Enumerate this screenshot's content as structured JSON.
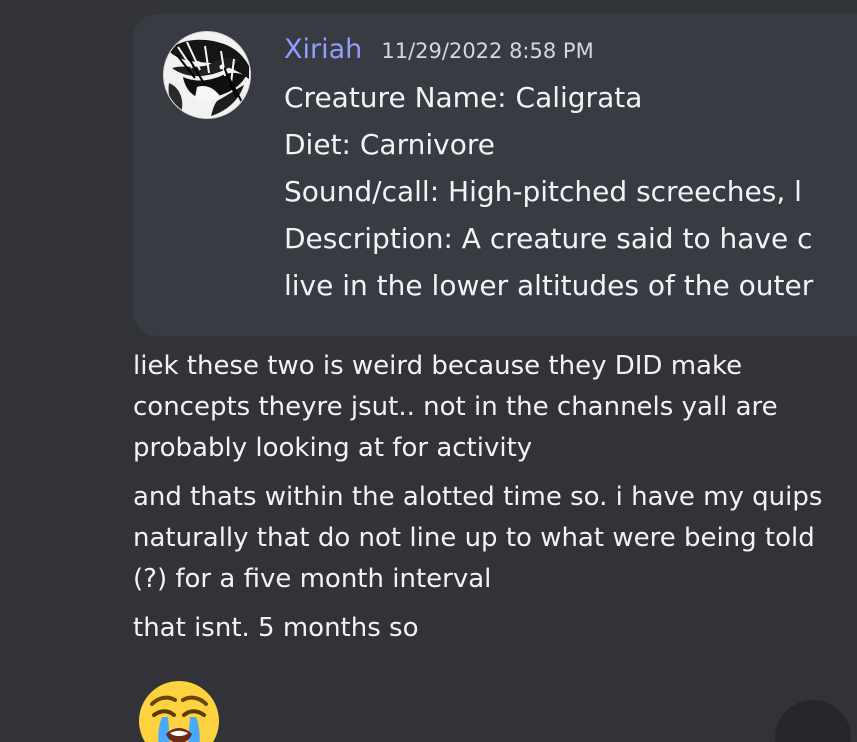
{
  "embed": {
    "author": "Xiriah",
    "timestamp": "11/29/2022 8:58 PM",
    "lines": [
      "Creature Name: Caligrata",
      "Diet: Carnivore",
      "Sound/call: High-pitched screeches, l",
      "Description: A creature said to have c",
      "live in the lower altitudes of the outer"
    ]
  },
  "messages": [
    "liek these two is weird because they DID make concepts theyre jsut.. not in the channels yall are probably looking at for activity",
    "and thats within the alotted time so. i have my quips naturally that do not line up to what were being told (?) for a five month interval",
    "that isnt. 5 months so"
  ],
  "icons": {
    "avatar": "avatar-icon",
    "emoji": "loudly-crying-face-icon",
    "corner": "round-button-icon"
  },
  "colors": {
    "background": "#313338",
    "embed_background": "#393b42",
    "author": "#939cff",
    "text": "#f2f3f5"
  }
}
